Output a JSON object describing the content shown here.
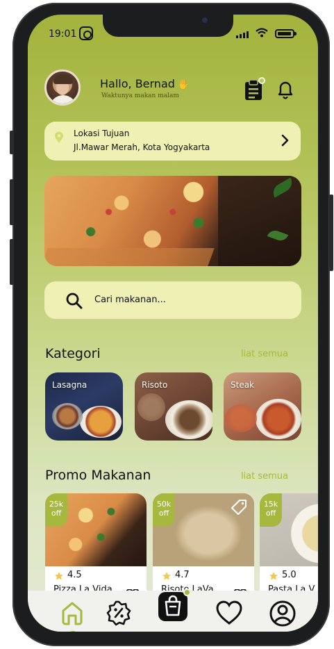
{
  "status": {
    "time": "19:01"
  },
  "header": {
    "greeting": "Hallo, Bernad",
    "subtitle": "Waktunya makan malam"
  },
  "location": {
    "label": "Lokasi Tujuan",
    "address": "Jl.Mawar Merah, Kota Yogyakarta"
  },
  "search": {
    "placeholder": "Cari makanan..."
  },
  "categories": {
    "title": "Kategori",
    "see_all": "liat semua",
    "items": [
      {
        "label": "Lasagna"
      },
      {
        "label": "Risoto"
      },
      {
        "label": "Steak"
      }
    ]
  },
  "promo": {
    "title": "Promo Makanan",
    "see_all": "liat semua",
    "items": [
      {
        "discount": "25k off",
        "rating": "4.5",
        "name": "Pizza La Vida"
      },
      {
        "discount": "50k off",
        "rating": "4.7",
        "name": "Risoto LaVa"
      },
      {
        "discount": "15k off",
        "rating": "5.0",
        "name": "Pasta La V"
      }
    ]
  },
  "colors": {
    "accent": "#a6b83e",
    "panel": "#eef0b4",
    "bg_top": "#a3b33c",
    "bg_bottom": "#e4ead6",
    "nav_bg": "#f1f1ee"
  },
  "icons": {
    "status": [
      "instagram-icon",
      "signal-icon",
      "wifi-icon",
      "battery-icon"
    ],
    "header": [
      "clipboard-icon",
      "bell-icon"
    ],
    "nav": [
      "home-icon",
      "discount-icon",
      "shopping-bag-icon",
      "heart-icon",
      "profile-icon"
    ]
  }
}
